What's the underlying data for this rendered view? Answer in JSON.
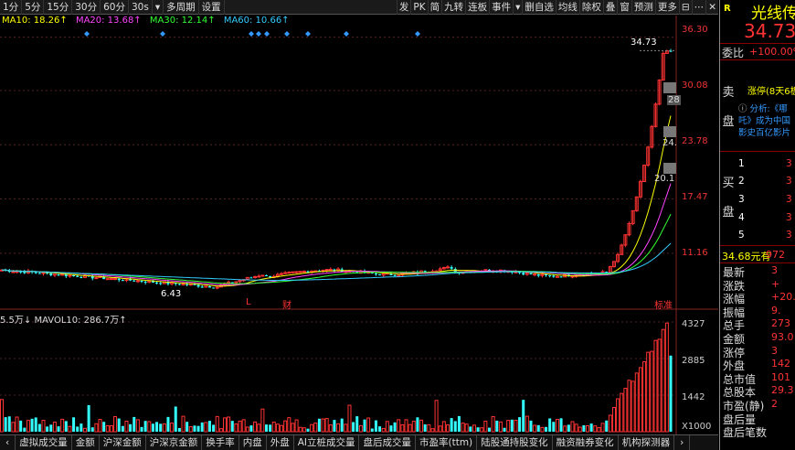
{
  "toolbar": {
    "left": [
      "1分",
      "5分",
      "15分",
      "30分",
      "60分",
      "30s",
      "▾",
      "多周期",
      "设置"
    ],
    "right": [
      "发",
      "PK",
      "简",
      "九转",
      "连板",
      "事件",
      "▾",
      "删自选",
      "均线",
      "除权",
      "叠",
      "窗",
      "预测",
      "更多"
    ],
    "icons": [
      "fullscreen-icon",
      "more-icon",
      "close-icon"
    ]
  },
  "ma_legend": [
    {
      "label": "MA10: 18.26↑",
      "color": "#ffff00"
    },
    {
      "label": "MA20: 13.68↑",
      "color": "#ff44ff"
    },
    {
      "label": "MA30: 12.14↑",
      "color": "#33ff33"
    },
    {
      "label": "MA60: 10.66↑",
      "color": "#33ccff"
    }
  ],
  "vol_legend": "5.5万↓  MAVOL10: 286.7万↑",
  "price_axis": [
    "36.30",
    "30.08",
    "23.78",
    "17.47",
    "11.16"
  ],
  "vol_axis": [
    "4327",
    "2885",
    "1442",
    "X1000"
  ],
  "chart_annotations": {
    "high_label": "34.73",
    "low_label": "6.43",
    "mid_labels": [
      "28",
      "24.",
      "20.1"
    ],
    "markers": [
      "L",
      "财",
      "标准"
    ]
  },
  "chart_data": {
    "type": "candlestick",
    "price_range": [
      5.5,
      37
    ],
    "volume_range": [
      0,
      4327
    ],
    "recent_closes": [
      9.6,
      10.2,
      11.0,
      12.1,
      13.3,
      14.6,
      16.1,
      17.7,
      19.5,
      21.4,
      23.5,
      25.9,
      28.5,
      31.3,
      34.4,
      34.7,
      34.68
    ],
    "ma_series": [
      {
        "name": "MA10",
        "last": 18.26,
        "color": "#ffff00"
      },
      {
        "name": "MA20",
        "last": 13.68,
        "color": "#ff44ff"
      },
      {
        "name": "MA30",
        "last": 12.14,
        "color": "#33ff33"
      },
      {
        "name": "MA60",
        "last": 10.66,
        "color": "#33ccff"
      }
    ]
  },
  "bottom_tabs": [
    "虚拟成交量",
    "金额",
    "沪深金额",
    "沪深京金额",
    "换手率",
    "内盘",
    "外盘",
    "AI立桩成交量",
    "盘后成交量",
    "市盈率(ttm)",
    "陆股通持股变化",
    "融资融券变化",
    "机构探测器"
  ],
  "right_panel": {
    "r_label": "R",
    "name": "光线传",
    "price": "34.73",
    "weibi_label": "委比",
    "weibi_value": "+100.00%",
    "sell_label_1": "卖",
    "sell_label_2": "盘",
    "limit_text": "涨停(8天6板)",
    "news": "分析:《哪吒》成为中国影史百亿影片",
    "buy_label_1": "买",
    "buy_label_2": "盘",
    "buy_rows": [
      {
        "n": "1",
        "v": "3"
      },
      {
        "n": "2",
        "v": "3"
      },
      {
        "n": "3",
        "v": "3"
      },
      {
        "n": "4",
        "v": "3"
      },
      {
        "n": "5",
        "v": "3"
      }
    ],
    "trade_price": "34.68元有",
    "trade_vol": "972",
    "stats": [
      {
        "label": "最新",
        "value": "3"
      },
      {
        "label": "涨跌",
        "value": "+"
      },
      {
        "label": "涨幅",
        "value": "+20."
      },
      {
        "label": "振幅",
        "value": "9."
      },
      {
        "label": "总手",
        "value": "273"
      },
      {
        "label": "金额",
        "value": "93.0"
      },
      {
        "label": "涨停",
        "value": "3"
      },
      {
        "label": "外盘",
        "value": "142"
      },
      {
        "label": "总市值",
        "value": "101"
      },
      {
        "label": "总股本",
        "value": "29.3"
      },
      {
        "label": "市盈(静)",
        "value": "2"
      },
      {
        "label": "盘后量",
        "value": ""
      },
      {
        "label": "盘后笔数",
        "value": ""
      }
    ]
  }
}
